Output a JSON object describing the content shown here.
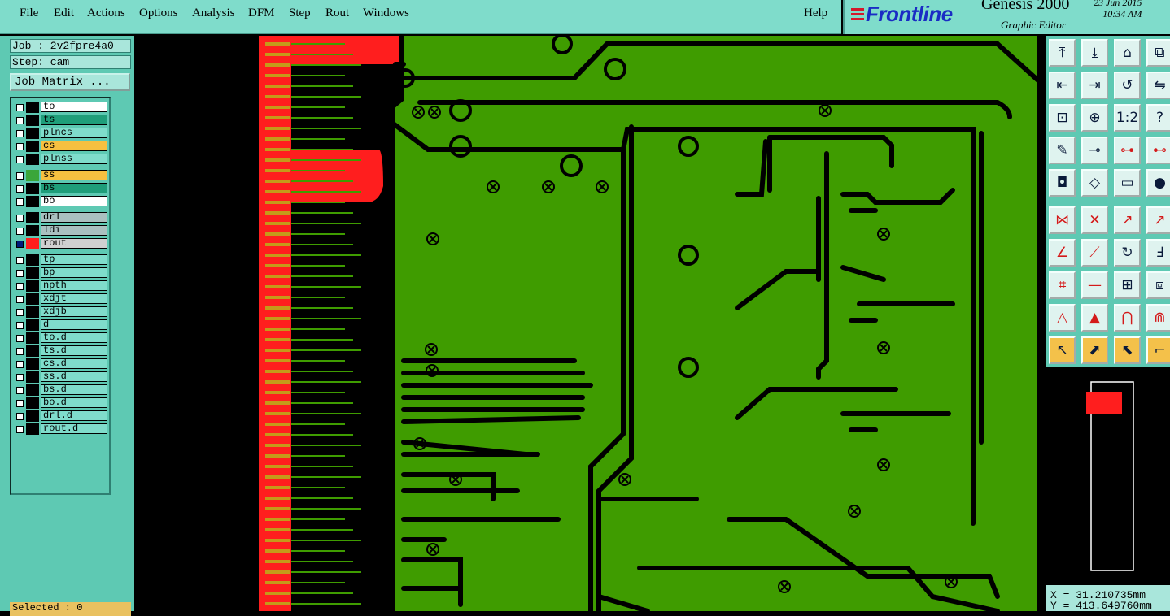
{
  "menu": {
    "items": [
      "File",
      "Edit",
      "Actions",
      "Options",
      "Analysis",
      "DFM",
      "Step",
      "Rout",
      "Windows"
    ],
    "help": "Help"
  },
  "brand": {
    "logo": "Frontline",
    "app": "Genesis 2000",
    "subtitle": "Graphic Editor",
    "date": "23 Jun 2015",
    "time": "10:34 AM"
  },
  "job": {
    "job_label": "Job : 2v2fpre4a0",
    "step_label": "Step: cam",
    "matrix_button": "Job Matrix ..."
  },
  "layers": [
    {
      "name": "to",
      "color": "#ffffff"
    },
    {
      "name": "ts",
      "color": "#1f9e7a"
    },
    {
      "name": "plncs",
      "color": "#7fdccb"
    },
    {
      "name": "cs",
      "color": "#f6c040"
    },
    {
      "name": "plnss",
      "color": "#7fdccb"
    },
    {
      "name": "ss",
      "color": "#f6c040",
      "swatch": "#3aa63a"
    },
    {
      "name": "bs",
      "color": "#1f9e7a"
    },
    {
      "name": "bo",
      "color": "#ffffff"
    },
    {
      "name": "drl",
      "color": "#a9c0c0"
    },
    {
      "name": "ldi",
      "color": "#a9c0c0"
    },
    {
      "name": "rout",
      "color": "#d0d0d0",
      "swatch": "#ff1e1e",
      "active": true
    },
    {
      "name": "tp",
      "color": "#7fdccb"
    },
    {
      "name": "bp",
      "color": "#7fdccb"
    },
    {
      "name": "npth",
      "color": "#7fdccb"
    },
    {
      "name": "xdjt",
      "color": "#7fdccb"
    },
    {
      "name": "xdjb",
      "color": "#7fdccb"
    },
    {
      "name": "d",
      "color": "#7fdccb"
    },
    {
      "name": "to.d",
      "color": "#7fdccb"
    },
    {
      "name": "ts.d",
      "color": "#7fdccb"
    },
    {
      "name": "cs.d",
      "color": "#7fdccb"
    },
    {
      "name": "ss.d",
      "color": "#7fdccb"
    },
    {
      "name": "bs.d",
      "color": "#7fdccb"
    },
    {
      "name": "bo.d",
      "color": "#7fdccb"
    },
    {
      "name": "drl.d",
      "color": "#7fdccb"
    },
    {
      "name": "rout.d",
      "color": "#7fdccb"
    }
  ],
  "status": {
    "selected": "Selected : 0",
    "x": "X = 31.210735mm",
    "y": "Y = 413.649760mm"
  },
  "tools": [
    "move-up-icon",
    "move-down-icon",
    "home-icon",
    "split-icon",
    "pan-left-icon",
    "pan-right-icon",
    "undo-redo-icon",
    "stretch-icon",
    "fit-icon",
    "zoom-center-icon",
    "scale-1-2-icon",
    "help-icon",
    "measure-icon",
    "snap-icon",
    "net-red-icon",
    "net-red-alt-icon",
    "pad-icon",
    "outline-icon",
    "ruler-icon",
    "dot-icon",
    "connect-icon",
    "cross-icon",
    "arrow-up-icon",
    "arrow-up-alt-icon",
    "line-icon",
    "line-alt-icon",
    "arc-icon",
    "text-icon",
    "pad-move-icon",
    "dash-icon",
    "component-icon",
    "copy-icon",
    "triangle-icon",
    "triangle-alt-icon",
    "arch-icon",
    "arch-alt-icon",
    "pointer-icon",
    "select-icon",
    "select-alt-icon",
    "route-icon"
  ],
  "colors": {
    "board": "#3f9c00",
    "copper_gap": "#000000",
    "rout": "#ff1e1e",
    "gold": "#c49a1a",
    "panel": "#5ec9b3"
  }
}
